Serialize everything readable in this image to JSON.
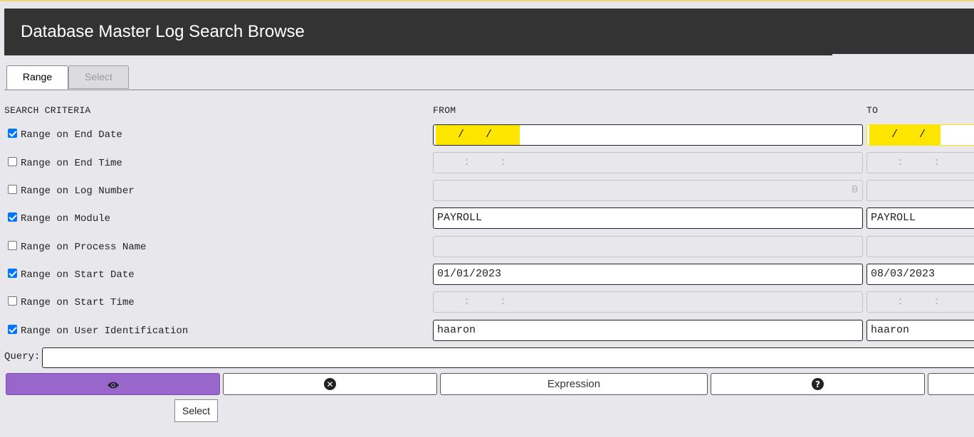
{
  "window": {
    "title": "Database Master Log Search Browse"
  },
  "tabs": [
    {
      "label": "Range",
      "active": true
    },
    {
      "label": "Select",
      "active": false
    }
  ],
  "headers": {
    "criteria": "SEARCH CRITERIA",
    "from": "FROM",
    "to": "TO"
  },
  "rows": [
    {
      "label": "Range on End Date",
      "checked": true,
      "from": " /  / ",
      "to": " /  / ",
      "highlighted": true
    },
    {
      "label": "Range on End Time",
      "checked": false,
      "from": " :  : ",
      "to": " :  : "
    },
    {
      "label": "Range on Log Number",
      "checked": false,
      "from": "0",
      "to": ""
    },
    {
      "label": "Range on Module",
      "checked": true,
      "from": "PAYROLL",
      "to": "PAYROLL"
    },
    {
      "label": "Range on Process Name",
      "checked": false,
      "from": "",
      "to": ""
    },
    {
      "label": "Range on Start Date",
      "checked": true,
      "from": "01/01/2023",
      "to": "08/03/2023"
    },
    {
      "label": "Range on Start Time",
      "checked": false,
      "from": " :  : ",
      "to": " :  : "
    },
    {
      "label": "Range on User Identification",
      "checked": true,
      "from": "haaron",
      "to": "haaron"
    }
  ],
  "query": {
    "label": "Query:",
    "value": ""
  },
  "buttons": {
    "view_icon": "eye-icon",
    "clear_icon": "times-circle-icon",
    "clear_glyph": "✕",
    "expression_label": "Expression",
    "help_icon": "question-circle-icon",
    "help_glyph": "?",
    "accent_color": "#9966cc"
  },
  "tooltip": {
    "text": "Select"
  },
  "colors": {
    "titlebar": "#333333",
    "highlight": "#ffe600",
    "checkbox": "#0075ff"
  }
}
